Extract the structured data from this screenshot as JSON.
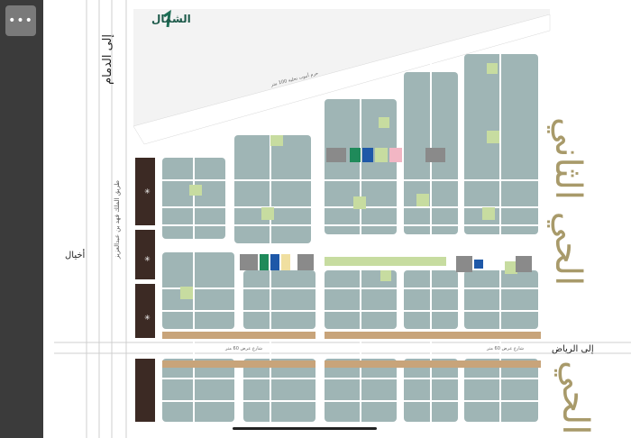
{
  "labels": {
    "north": "الشمال",
    "to_dammam": "إلى الدمام",
    "king_road": "طريق الملك فهد بن عبدالعزيز",
    "akhyal": "أخيال",
    "to_riyadh": "إلى الرياض",
    "district_second": "الحي الثاني",
    "district_other": "الحي",
    "corridor": "حرم أنبوب تحلية 100 متر",
    "street_mid": "شارع عرض 60 متر",
    "street_mid2": "شارع عرض 60 متر"
  },
  "colors": {
    "block": "#9fb5b5",
    "road": "#ffffff",
    "commercial": "#3c2a24",
    "park": "#c7dca0",
    "service": "#c8a47a",
    "district_text": "#a89a6a"
  },
  "icons": {
    "menu": "ellipsis-icon",
    "north": "north-arrow-icon"
  }
}
